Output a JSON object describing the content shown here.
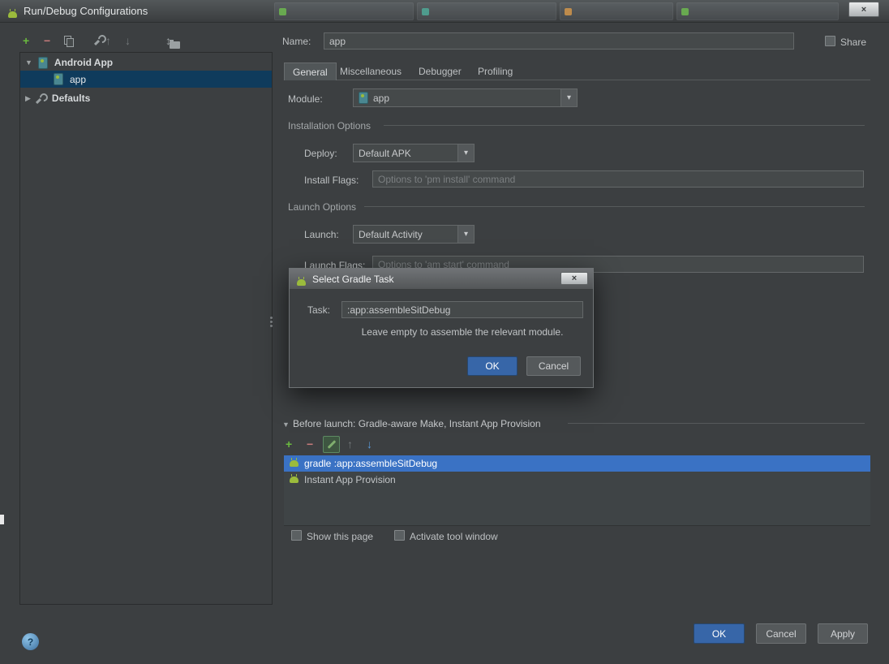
{
  "window": {
    "title": "Run/Debug Configurations"
  },
  "icons": {
    "add": "+",
    "remove": "−",
    "move_up": "↑",
    "move_down": "↓",
    "dropdown": "▾",
    "expanded": "▼",
    "collapsed": "▶",
    "close": "×",
    "help": "?",
    "sort": "↕"
  },
  "colors": {
    "android_green": "#9bbb3c",
    "selection_navy": "#0f3b5c",
    "selection_blue": "#3a72c4",
    "primary_button_blue": "#3766a8"
  },
  "sidebar": {
    "tree": [
      {
        "label": "Android App"
      },
      {
        "label": "app"
      },
      {
        "label": "Defaults"
      }
    ]
  },
  "form": {
    "name_label": "Name:",
    "name_value": "app",
    "share_label": "Share",
    "tabs": [
      {
        "label": "General"
      },
      {
        "label": "Miscellaneous"
      },
      {
        "label": "Debugger"
      },
      {
        "label": "Profiling"
      }
    ],
    "module_label": "Module:",
    "module_value": "app",
    "installation_section": "Installation Options",
    "deploy_label": "Deploy:",
    "deploy_value": "Default APK",
    "install_flags_label": "Install Flags:",
    "install_flags_placeholder": "Options to 'pm install' command",
    "launch_section": "Launch Options",
    "launch_label": "Launch:",
    "launch_value": "Default Activity",
    "launch_flags_label": "Launch Flags:",
    "launch_flags_placeholder": "Options to 'am start' command"
  },
  "dialog": {
    "title": "Select Gradle Task",
    "task_label": "Task:",
    "task_value": ":app:assembleSitDebug",
    "hint": "Leave empty to assemble the relevant module.",
    "ok_label": "OK",
    "cancel_label": "Cancel"
  },
  "before_launch": {
    "header": "Before launch: Gradle-aware Make, Instant App Provision",
    "items": [
      {
        "label": "gradle :app:assembleSitDebug"
      },
      {
        "label": "Instant App Provision"
      }
    ]
  },
  "footer": {
    "show_this_page": "Show this page",
    "activate_tool_window": "Activate tool window",
    "ok_label": "OK",
    "cancel_label": "Cancel",
    "apply_label": "Apply"
  }
}
